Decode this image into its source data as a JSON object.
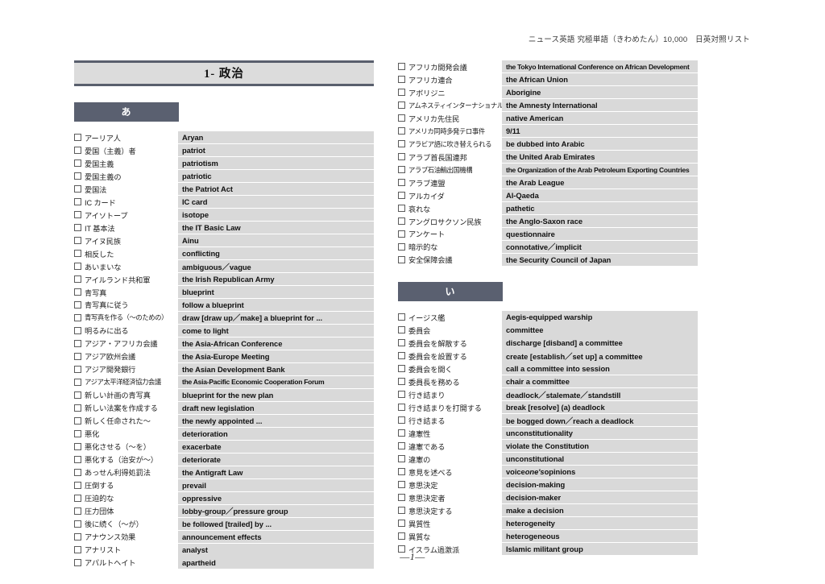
{
  "header": {
    "running_head": "ニュース英語 究極単語（きわめたん）10,000　日英対照リスト"
  },
  "chapter": {
    "number": "1",
    "title": "1- 政治"
  },
  "page_number": "—1—",
  "colors": {
    "section_header_bg": "#5a6070",
    "row_bg": "#d9d9d9",
    "title_bar_bg": "#dcdcdc",
    "title_bar_border": "#595f6d"
  },
  "sections": [
    {
      "kana": "あ",
      "column": "left",
      "entries": [
        {
          "jp": "アーリア人",
          "en": "Aryan"
        },
        {
          "jp": "愛国（主義）者",
          "en": "patriot"
        },
        {
          "jp": "愛国主義",
          "en": "patriotism"
        },
        {
          "jp": "愛国主義の",
          "en": "patriotic"
        },
        {
          "jp": "愛国法",
          "en": "the Patriot Act"
        },
        {
          "jp": "IC カード",
          "en": "IC card"
        },
        {
          "jp": "アイソトープ",
          "en": "isotope"
        },
        {
          "jp": "IT 基本法",
          "en": "the IT Basic Law"
        },
        {
          "jp": "アイヌ民族",
          "en": "Ainu"
        },
        {
          "jp": "相反した",
          "en": "conflicting"
        },
        {
          "jp": "あいまいな",
          "en": "ambiguous／vague"
        },
        {
          "jp": "アイルランド共和軍",
          "en": "the Irish Republican Army"
        },
        {
          "jp": "青写真",
          "en": "blueprint"
        },
        {
          "jp": "青写真に従う",
          "en": "follow a blueprint"
        },
        {
          "jp": "青写真を作る（〜のための）",
          "en": "draw [draw up／make] a blueprint for ...",
          "jp_tight": true
        },
        {
          "jp": "明るみに出る",
          "en": "come to light"
        },
        {
          "jp": "アジア・アフリカ会議",
          "en": "the Asia-African Conference"
        },
        {
          "jp": "アジア欧州会議",
          "en": "the Asia-Europe Meeting"
        },
        {
          "jp": "アジア開発銀行",
          "en": "the Asian Development Bank"
        },
        {
          "jp": "アジア太平洋経済協力会議",
          "en": "the Asia-Pacific Economic Cooperation Forum",
          "jp_tight": true,
          "en_squeeze": true
        },
        {
          "jp": "新しい計画の青写真",
          "en": "blueprint for the new plan"
        },
        {
          "jp": "新しい法案を作成する",
          "en": "draft new legislation"
        },
        {
          "jp": "新しく任命された〜",
          "en": "the newly appointed ..."
        },
        {
          "jp": "悪化",
          "en": "deterioration"
        },
        {
          "jp": "悪化させる（〜を）",
          "en": "exacerbate"
        },
        {
          "jp": "悪化する（治安が〜）",
          "en": "deteriorate"
        },
        {
          "jp": "あっせん利得処罰法",
          "en": "the Antigraft Law"
        },
        {
          "jp": "圧倒する",
          "en": "prevail"
        },
        {
          "jp": "圧迫的な",
          "en": "oppressive"
        },
        {
          "jp": "圧力団体",
          "en": "lobby-group／pressure group"
        },
        {
          "jp": "後に続く（〜が）",
          "en": "be followed [trailed] by ..."
        },
        {
          "jp": "アナウンス効果",
          "en": "announcement effects"
        },
        {
          "jp": "アナリスト",
          "en": "analyst"
        },
        {
          "jp": "アパルトヘイト",
          "en": "apartheid"
        }
      ]
    },
    {
      "kana": "",
      "column": "right",
      "entries": [
        {
          "jp": "アフリカ開発会議",
          "en": "the Tokyo International Conference on African Development",
          "en_squeeze": true
        },
        {
          "jp": "アフリカ連合",
          "en": "the African Union"
        },
        {
          "jp": "アボリジニ",
          "en": "Aborigine"
        },
        {
          "jp": "アムネスティインターナショナル",
          "en": "the Amnesty International",
          "jp_tight": true
        },
        {
          "jp": "アメリカ先住民",
          "en": "native American"
        },
        {
          "jp": "アメリカ同時多発テロ事件",
          "en": "9/11",
          "jp_tight": true
        },
        {
          "jp": "アラビア語に吹き替えられる",
          "en": "be dubbed into Arabic",
          "jp_tight": true
        },
        {
          "jp": "アラブ首長国連邦",
          "en": "the United Arab Emirates"
        },
        {
          "jp": "アラブ石油輸出国機構",
          "en": "the Organization of the Arab Petroleum Exporting Countries",
          "jp_tight": true,
          "en_squeeze": true
        },
        {
          "jp": "アラブ連盟",
          "en": "the Arab League"
        },
        {
          "jp": "アルカイダ",
          "en": "Al-Qaeda"
        },
        {
          "jp": "哀れな",
          "en": "pathetic"
        },
        {
          "jp": "アングロサクソン民族",
          "en": "the Anglo-Saxon race"
        },
        {
          "jp": "アンケート",
          "en": "questionnaire"
        },
        {
          "jp": "暗示的な",
          "en": "connotative／implicit"
        },
        {
          "jp": "安全保障会議",
          "en": "the Security Council of Japan"
        }
      ]
    },
    {
      "kana": "い",
      "column": "right",
      "entries": [
        {
          "jp": "イージス艦",
          "en": "Aegis-equipped warship"
        },
        {
          "jp": "委員会",
          "en": "committee"
        },
        {
          "jp": "委員会を解散する",
          "en": "discharge [disband] a committee"
        },
        {
          "jp": "委員会を設置する",
          "en": "create [establish／set up] a committee"
        },
        {
          "jp": "委員会を開く",
          "en": "call a committee into session"
        },
        {
          "jp": "委員長を務める",
          "en": "chair a committee"
        },
        {
          "jp": "行き詰まり",
          "en": "deadlock／stalemate／standstill"
        },
        {
          "jp": "行き詰まりを打開する",
          "en": "break [resolve] (a) deadlock"
        },
        {
          "jp": "行き詰まる",
          "en": "be bogged down／reach a deadlock"
        },
        {
          "jp": "違憲性",
          "en": "unconstitutionality"
        },
        {
          "jp": "違憲である",
          "en": "violate the Constitution"
        },
        {
          "jp": "違憲の",
          "en": "unconstitutional"
        },
        {
          "jp": "意見を述べる",
          "en_html": "voice <i>one's</i> opinions"
        },
        {
          "jp": "意思決定",
          "en": "decision-making"
        },
        {
          "jp": "意思決定者",
          "en": "decision-maker"
        },
        {
          "jp": "意思決定する",
          "en": "make a decision"
        },
        {
          "jp": "異質性",
          "en": "heterogeneity"
        },
        {
          "jp": "異質な",
          "en": "heterogeneous"
        },
        {
          "jp": "イスラム過激派",
          "en": "Islamic militant group"
        }
      ]
    }
  ]
}
